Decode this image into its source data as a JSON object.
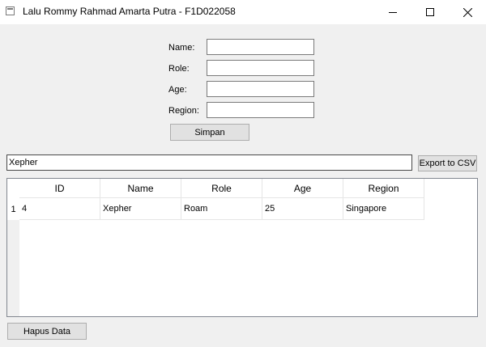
{
  "window": {
    "title": "Lalu Rommy Rahmad Amarta Putra - F1D022058"
  },
  "form": {
    "name_label": "Name:",
    "role_label": "Role:",
    "age_label": "Age:",
    "region_label": "Region:",
    "name_value": "",
    "role_value": "",
    "age_value": "",
    "region_value": "",
    "save_label": "Simpan"
  },
  "search": {
    "value": "Xepher"
  },
  "export_label": "Export to CSV",
  "table": {
    "headers": [
      "ID",
      "Name",
      "Role",
      "Age",
      "Region"
    ],
    "rows": [
      {
        "row_number": "1",
        "cells": [
          "4",
          "Xepher",
          "Roam",
          "25",
          "Singapore"
        ]
      }
    ]
  },
  "delete_label": "Hapus Data"
}
